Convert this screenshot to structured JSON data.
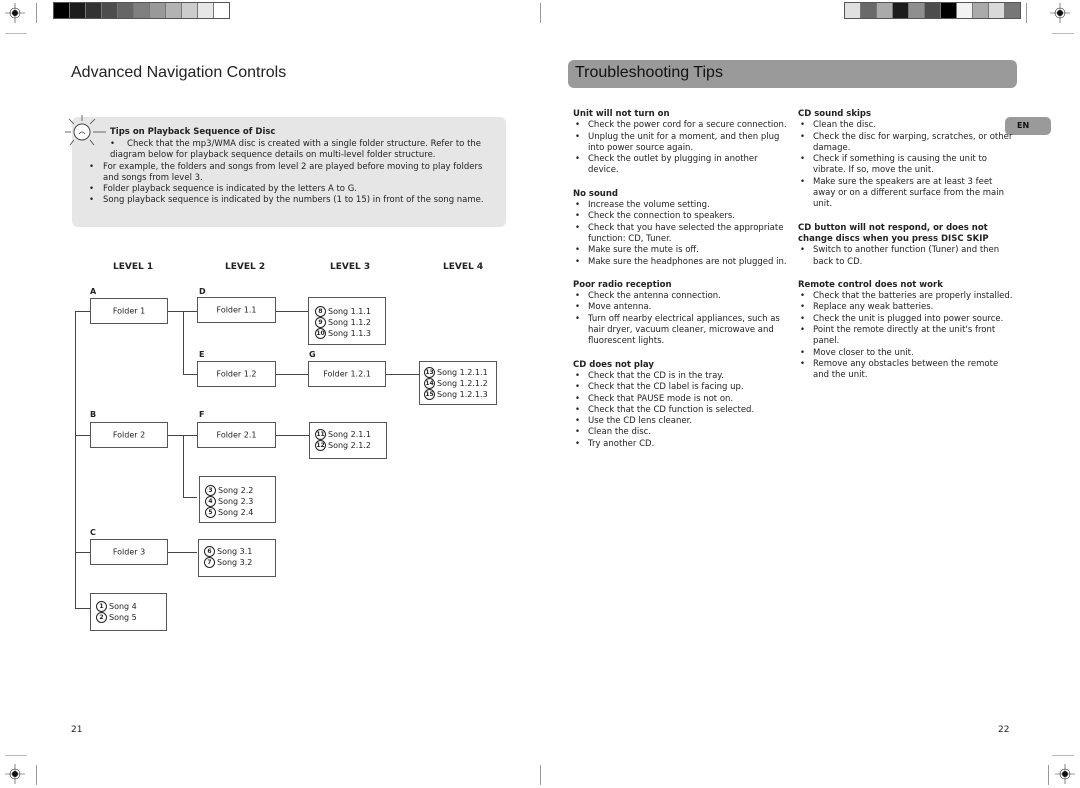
{
  "left_page": {
    "title": "Advanced Navigation Controls",
    "page_number": "21",
    "tips": {
      "icon": "lightbulb-icon",
      "title": "Tips on Playback Sequence of Disc",
      "items": [
        "Check that the mp3/WMA disc is created with a single folder structure. Refer to the diagram below for playback sequence details on multi-level folder structure.",
        "For example, the folders and songs from level 2 are played before moving to play folders and songs from level 3.",
        "Folder playback sequence is indicated by the letters A to G.",
        "Song playback sequence is indicated by the numbers (1 to 15) in front of the song name."
      ]
    },
    "diagram": {
      "levels": [
        "LEVEL 1",
        "LEVEL 2",
        "LEVEL 3",
        "LEVEL 4"
      ],
      "folders": {
        "A": {
          "letter": "A",
          "name": "Folder 1"
        },
        "B": {
          "letter": "B",
          "name": "Folder 2"
        },
        "C": {
          "letter": "C",
          "name": "Folder 3"
        },
        "D": {
          "letter": "D",
          "name": "Folder 1.1"
        },
        "E": {
          "letter": "E",
          "name": "Folder 1.2"
        },
        "F": {
          "letter": "F",
          "name": "Folder 2.1"
        },
        "G": {
          "letter": "G",
          "name": "Folder 1.2.1"
        }
      },
      "song_groups": {
        "g111": [
          {
            "n": "8",
            "name": "Song 1.1.1"
          },
          {
            "n": "9",
            "name": "Song 1.1.2"
          },
          {
            "n": "10",
            "name": "Song 1.1.3"
          }
        ],
        "g1211": [
          {
            "n": "13",
            "name": "Song 1.2.1.1"
          },
          {
            "n": "14",
            "name": "Song 1.2.1.2"
          },
          {
            "n": "15",
            "name": "Song 1.2.1.3"
          }
        ],
        "g21": [
          {
            "n": "11",
            "name": "Song 2.1.1"
          },
          {
            "n": "12",
            "name": "Song 2.1.2"
          }
        ],
        "g2": [
          {
            "n": "3",
            "name": "Song 2.2"
          },
          {
            "n": "4",
            "name": "Song 2.3"
          },
          {
            "n": "5",
            "name": "Song 2.4"
          }
        ],
        "g3": [
          {
            "n": "6",
            "name": "Song 3.1"
          },
          {
            "n": "7",
            "name": "Song 3.2"
          }
        ],
        "groot": [
          {
            "n": "1",
            "name": "Song 4"
          },
          {
            "n": "2",
            "name": "Song 5"
          }
        ]
      }
    }
  },
  "right_page": {
    "title": "Troubleshooting Tips",
    "page_number": "22",
    "language_badge": "EN",
    "sections": [
      {
        "heading": "Unit will not turn on",
        "items": [
          "Check the power cord for a secure connection.",
          "Unplug the unit for a moment, and then plug into power source again.",
          "Check the outlet by plugging in another device."
        ]
      },
      {
        "heading": "No sound",
        "items": [
          "Increase the volume setting.",
          "Check the connection to speakers.",
          "Check that you have selected the appropriate function: CD, Tuner.",
          "Make sure the mute is off.",
          "Make sure the headphones are not plugged in."
        ]
      },
      {
        "heading": "Poor radio reception",
        "items": [
          "Check the antenna connection.",
          "Move antenna.",
          "Turn off nearby electrical appliances, such as hair dryer, vacuum cleaner, microwave and fluorescent lights."
        ]
      },
      {
        "heading": "CD does not play",
        "items": [
          "Check that the CD is in the tray.",
          "Check that the CD label is facing up.",
          "Check that PAUSE mode is not on.",
          "Check that the CD function is selected.",
          "Use the CD lens cleaner.",
          "Clean the disc.",
          "Try another CD."
        ]
      },
      {
        "heading": "CD sound skips",
        "items": [
          "Clean the disc.",
          "Check the disc for warping, scratches, or other damage.",
          "Check if something is causing the unit to vibrate. If so, move the unit.",
          "Make sure the speakers are at least 3 feet away or on a different surface from the main unit."
        ]
      },
      {
        "heading": "CD button will not respond, or does not change discs when you press DISC SKIP",
        "items": [
          "Switch to another function (Tuner) and then back to CD."
        ]
      },
      {
        "heading": "Remote control does not work",
        "items": [
          "Check that the batteries are properly installed.",
          "Replace any weak batteries.",
          "Check the unit is plugged into power source.",
          "Point the remote directly at the unit's front panel.",
          "Move closer to the unit.",
          "Remove any obstacles between the remote and the unit."
        ]
      }
    ]
  },
  "print_marks": {
    "left_swatches": [
      "#000000",
      "#1c1c1c",
      "#333333",
      "#4d4d4d",
      "#666666",
      "#808080",
      "#999999",
      "#b3b3b3",
      "#cccccc",
      "#e6e6e6",
      "#ffffff"
    ],
    "right_swatches": [
      "#e0e0e0",
      "#6a6a6a",
      "#aaaaaa",
      "#1c1c1c",
      "#8f8f8f",
      "#4d4d4d",
      "#000000",
      "#f2f2f2",
      "#aaaaaa",
      "#d9d9d9",
      "#777777"
    ]
  }
}
